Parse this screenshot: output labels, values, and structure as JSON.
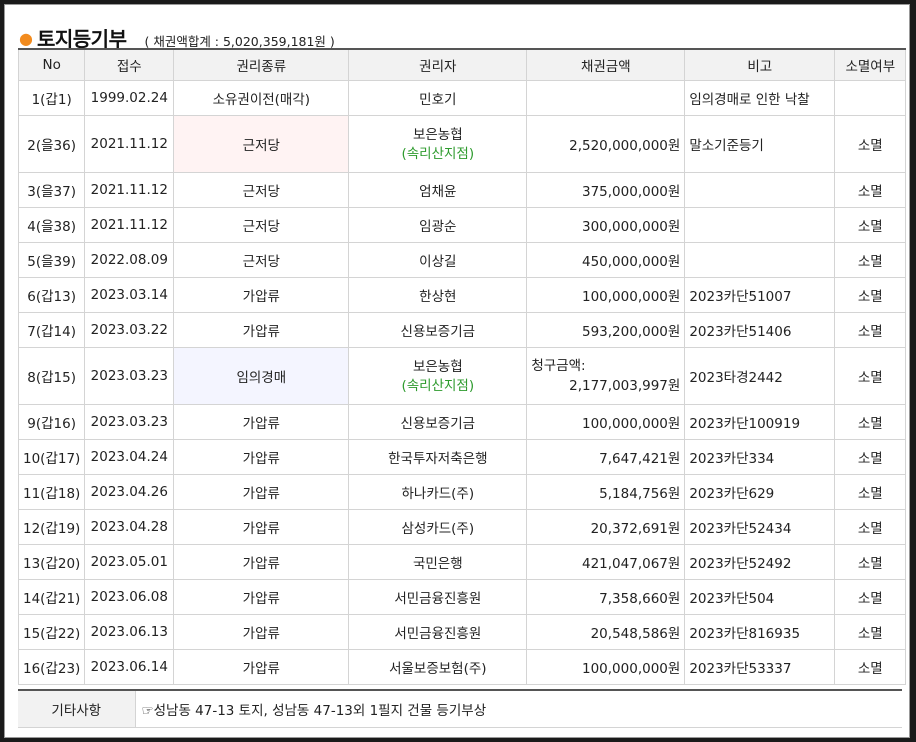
{
  "section": {
    "title": "토지등기부",
    "summary": "( 채권액합계 : 5,020,359,181원 )"
  },
  "columns": [
    "No",
    "접수",
    "권리종류",
    "권리자",
    "채권금액",
    "비고",
    "소멸여부"
  ],
  "rows": [
    {
      "no": "1(갑1)",
      "date": "1999.02.24",
      "type": "소유권이전(매각)",
      "holder": "민호기",
      "holder_sub": "",
      "claim_label": "",
      "amount": "",
      "note": "임의경매로 인한 낙찰",
      "status": ""
    },
    {
      "no": "2(을36)",
      "date": "2021.11.12",
      "type": "근저당",
      "holder": "보은농협",
      "holder_sub": "(속리산지점)",
      "claim_label": "",
      "amount": "2,520,000,000원",
      "note": "말소기준등기",
      "status": "소멸"
    },
    {
      "no": "3(을37)",
      "date": "2021.11.12",
      "type": "근저당",
      "holder": "엄채윤",
      "holder_sub": "",
      "claim_label": "",
      "amount": "375,000,000원",
      "note": "",
      "status": "소멸"
    },
    {
      "no": "4(을38)",
      "date": "2021.11.12",
      "type": "근저당",
      "holder": "임광순",
      "holder_sub": "",
      "claim_label": "",
      "amount": "300,000,000원",
      "note": "",
      "status": "소멸"
    },
    {
      "no": "5(을39)",
      "date": "2022.08.09",
      "type": "근저당",
      "holder": "이상길",
      "holder_sub": "",
      "claim_label": "",
      "amount": "450,000,000원",
      "note": "",
      "status": "소멸"
    },
    {
      "no": "6(갑13)",
      "date": "2023.03.14",
      "type": "가압류",
      "holder": "한상현",
      "holder_sub": "",
      "claim_label": "",
      "amount": "100,000,000원",
      "note": "2023카단51007",
      "status": "소멸"
    },
    {
      "no": "7(갑14)",
      "date": "2023.03.22",
      "type": "가압류",
      "holder": "신용보증기금",
      "holder_sub": "",
      "claim_label": "",
      "amount": "593,200,000원",
      "note": "2023카단51406",
      "status": "소멸"
    },
    {
      "no": "8(갑15)",
      "date": "2023.03.23",
      "type": "임의경매",
      "holder": "보은농협",
      "holder_sub": "(속리산지점)",
      "claim_label": "청구금액:",
      "amount": "2,177,003,997원",
      "note": "2023타경2442",
      "status": "소멸"
    },
    {
      "no": "9(갑16)",
      "date": "2023.03.23",
      "type": "가압류",
      "holder": "신용보증기금",
      "holder_sub": "",
      "claim_label": "",
      "amount": "100,000,000원",
      "note": "2023카단100919",
      "status": "소멸"
    },
    {
      "no": "10(갑17)",
      "date": "2023.04.24",
      "type": "가압류",
      "holder": "한국투자저축은행",
      "holder_sub": "",
      "claim_label": "",
      "amount": "7,647,421원",
      "note": "2023카단334",
      "status": "소멸"
    },
    {
      "no": "11(갑18)",
      "date": "2023.04.26",
      "type": "가압류",
      "holder": "하나카드(주)",
      "holder_sub": "",
      "claim_label": "",
      "amount": "5,184,756원",
      "note": "2023카단629",
      "status": "소멸"
    },
    {
      "no": "12(갑19)",
      "date": "2023.04.28",
      "type": "가압류",
      "holder": "삼성카드(주)",
      "holder_sub": "",
      "claim_label": "",
      "amount": "20,372,691원",
      "note": "2023카단52434",
      "status": "소멸"
    },
    {
      "no": "13(갑20)",
      "date": "2023.05.01",
      "type": "가압류",
      "holder": "국민은행",
      "holder_sub": "",
      "claim_label": "",
      "amount": "421,047,067원",
      "note": "2023카단52492",
      "status": "소멸"
    },
    {
      "no": "14(갑21)",
      "date": "2023.06.08",
      "type": "가압류",
      "holder": "서민금융진흥원",
      "holder_sub": "",
      "claim_label": "",
      "amount": "7,358,660원",
      "note": "2023카단504",
      "status": "소멸"
    },
    {
      "no": "15(갑22)",
      "date": "2023.06.13",
      "type": "가압류",
      "holder": "서민금융진흥원",
      "holder_sub": "",
      "claim_label": "",
      "amount": "20,548,586원",
      "note": "2023카단816935",
      "status": "소멸"
    },
    {
      "no": "16(갑23)",
      "date": "2023.06.14",
      "type": "가압류",
      "holder": "서울보증보험(주)",
      "holder_sub": "",
      "claim_label": "",
      "amount": "100,000,000원",
      "note": "2023카단53337",
      "status": "소멸"
    }
  ],
  "etc": {
    "label": "기타사항",
    "text": "☞성남동 47-13 토지, 성남동 47-13외 1필지 건물 등기부상"
  },
  "colors": {
    "accent_dot": "#f28b1e",
    "holder_sub": "#2e9b2e",
    "highlight_pink": "#fff3f3",
    "highlight_blue": "#f4f5ff"
  }
}
